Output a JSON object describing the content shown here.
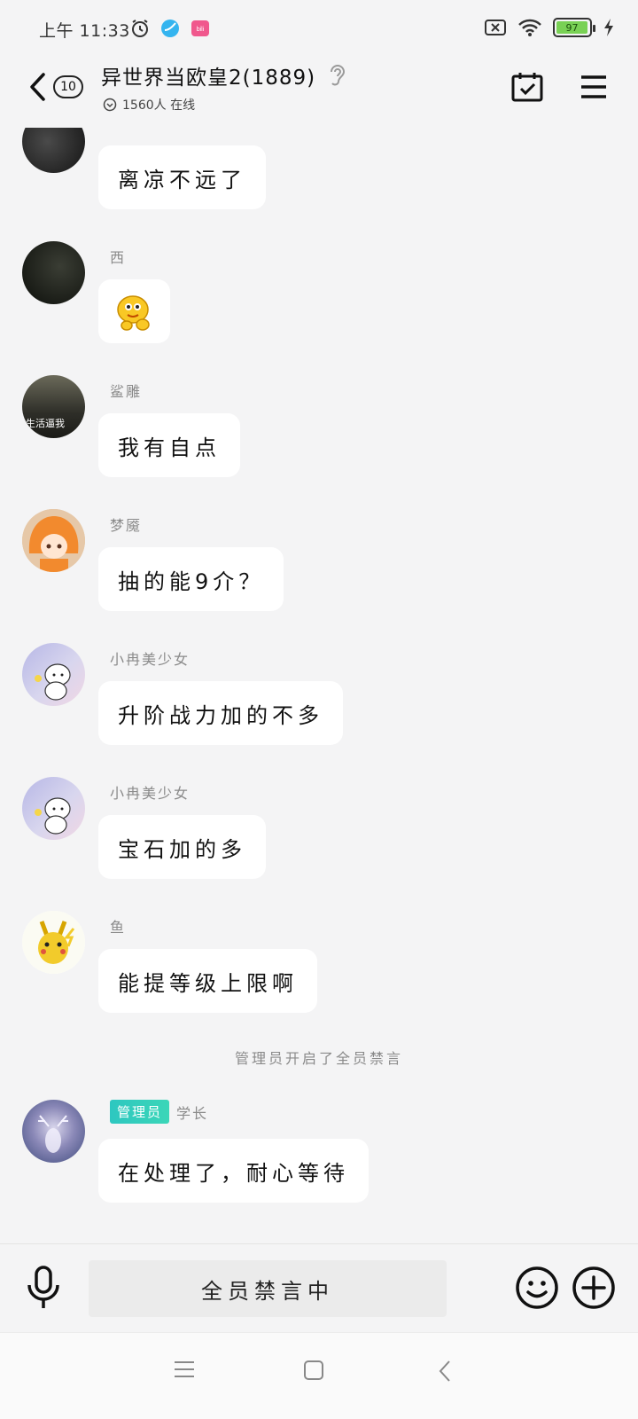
{
  "status_bar": {
    "time": "上午 11:33",
    "battery_level": "97",
    "battery_color": "#79d155"
  },
  "header": {
    "unread_count": "10",
    "title": "异世界当欧皇2(1889)",
    "online": "1560人 在线",
    "icons": [
      "back-icon",
      "ear-icon",
      "calendar-check-icon",
      "menu-icon"
    ]
  },
  "messages": [
    {
      "sender": "",
      "text": "离凉不远了"
    },
    {
      "sender": "西",
      "text": "",
      "sticker": "yellow-blob-sticker"
    },
    {
      "sender": "鲨雕",
      "text": "我有自点",
      "avatar_caption": "生活逼我"
    },
    {
      "sender": "梦魇",
      "text": "抽的能9介？"
    },
    {
      "sender": "小冉美少女",
      "text": "升阶战力加的不多"
    },
    {
      "sender": "小冉美少女",
      "text": "宝石加的多"
    },
    {
      "sender": "鱼",
      "text": "能提等级上限啊"
    }
  ],
  "system_notice": "管理员开启了全员禁言",
  "admin_message": {
    "role_badge": "管理员",
    "sender": "学长",
    "text": "在处理了，耐心等待"
  },
  "input_bar": {
    "mute_text": "全员禁言中",
    "icons": [
      "mic-icon",
      "smiley-icon",
      "plus-circle-icon"
    ]
  },
  "nav_bar": {
    "icons": [
      "recents-icon",
      "home-icon",
      "back-nav-icon"
    ]
  },
  "colors": {
    "background": "#f4f4f5",
    "bubble": "#ffffff",
    "admin_badge": "#2ec7c0"
  }
}
